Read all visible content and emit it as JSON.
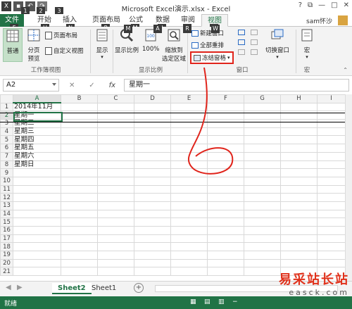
{
  "window": {
    "title": "Microsoft Excel演示.xlsx - Excel",
    "user": "sam怀沙",
    "help_glyph": "?",
    "restore_glyph": "⧉",
    "minimize_glyph": "—",
    "maximize_glyph": "□",
    "close_glyph": "✕"
  },
  "qat": {
    "keytips": [
      "1",
      "2",
      "3"
    ]
  },
  "tabs": {
    "file": "文件",
    "home": "开始",
    "insert": "插入",
    "page_layout": "页面布局",
    "formulas": "公式",
    "data": "数据",
    "review": "审阅",
    "view": "视图",
    "keytips": [
      "F",
      "H",
      "N",
      "P",
      "M",
      "A",
      "R",
      "W"
    ]
  },
  "ribbon": {
    "normal": "普通",
    "page_break_1": "分页",
    "page_break_2": "预览",
    "page_layout": "页面布局",
    "custom_views": "自定义视图",
    "workbook_views_label": "工作簿视图",
    "show": "显示",
    "zoom": "显示比例",
    "zoom100": "100%",
    "zoom_sel_1": "缩放到",
    "zoom_sel_2": "选定区域",
    "zoom_group_label": "显示比例",
    "new_window": "新建窗口",
    "arrange_all": "全部重排",
    "freeze_panes": "冻结窗格",
    "window_group_label": "窗口",
    "switch_windows": "切换窗口",
    "macros": "宏",
    "macros_group_label": "宏"
  },
  "formula_bar": {
    "name_box": "A2",
    "cancel": "✕",
    "enter": "✓",
    "fx": "fx",
    "value": "星期一"
  },
  "grid": {
    "columns": [
      "A",
      "B",
      "C",
      "D",
      "E",
      "F",
      "G",
      "H",
      "I"
    ],
    "rows": [
      {
        "n": "1",
        "a": " 2014年11月"
      },
      {
        "n": "2",
        "a": "星期一"
      },
      {
        "n": "3",
        "a": "星期二"
      },
      {
        "n": "4",
        "a": "星期三"
      },
      {
        "n": "5",
        "a": "星期四"
      },
      {
        "n": "6",
        "a": "星期五"
      },
      {
        "n": "7",
        "a": "星期六"
      },
      {
        "n": "8",
        "a": "星期日"
      },
      {
        "n": "9",
        "a": ""
      },
      {
        "n": "10",
        "a": ""
      },
      {
        "n": "11",
        "a": ""
      },
      {
        "n": "12",
        "a": ""
      },
      {
        "n": "13",
        "a": ""
      },
      {
        "n": "14",
        "a": ""
      },
      {
        "n": "15",
        "a": ""
      },
      {
        "n": "16",
        "a": ""
      },
      {
        "n": "17",
        "a": ""
      },
      {
        "n": "18",
        "a": ""
      },
      {
        "n": "19",
        "a": ""
      },
      {
        "n": "20",
        "a": ""
      },
      {
        "n": "21",
        "a": ""
      }
    ]
  },
  "sheets": {
    "tabs": [
      "Sheet2",
      "Sheet1"
    ],
    "active": "Sheet2",
    "add": "+",
    "nav_prev": "◀",
    "nav_next": "▶"
  },
  "status": {
    "ready": "就绪"
  },
  "watermark": {
    "cn": "易采站长站",
    "en": "easck.com"
  }
}
